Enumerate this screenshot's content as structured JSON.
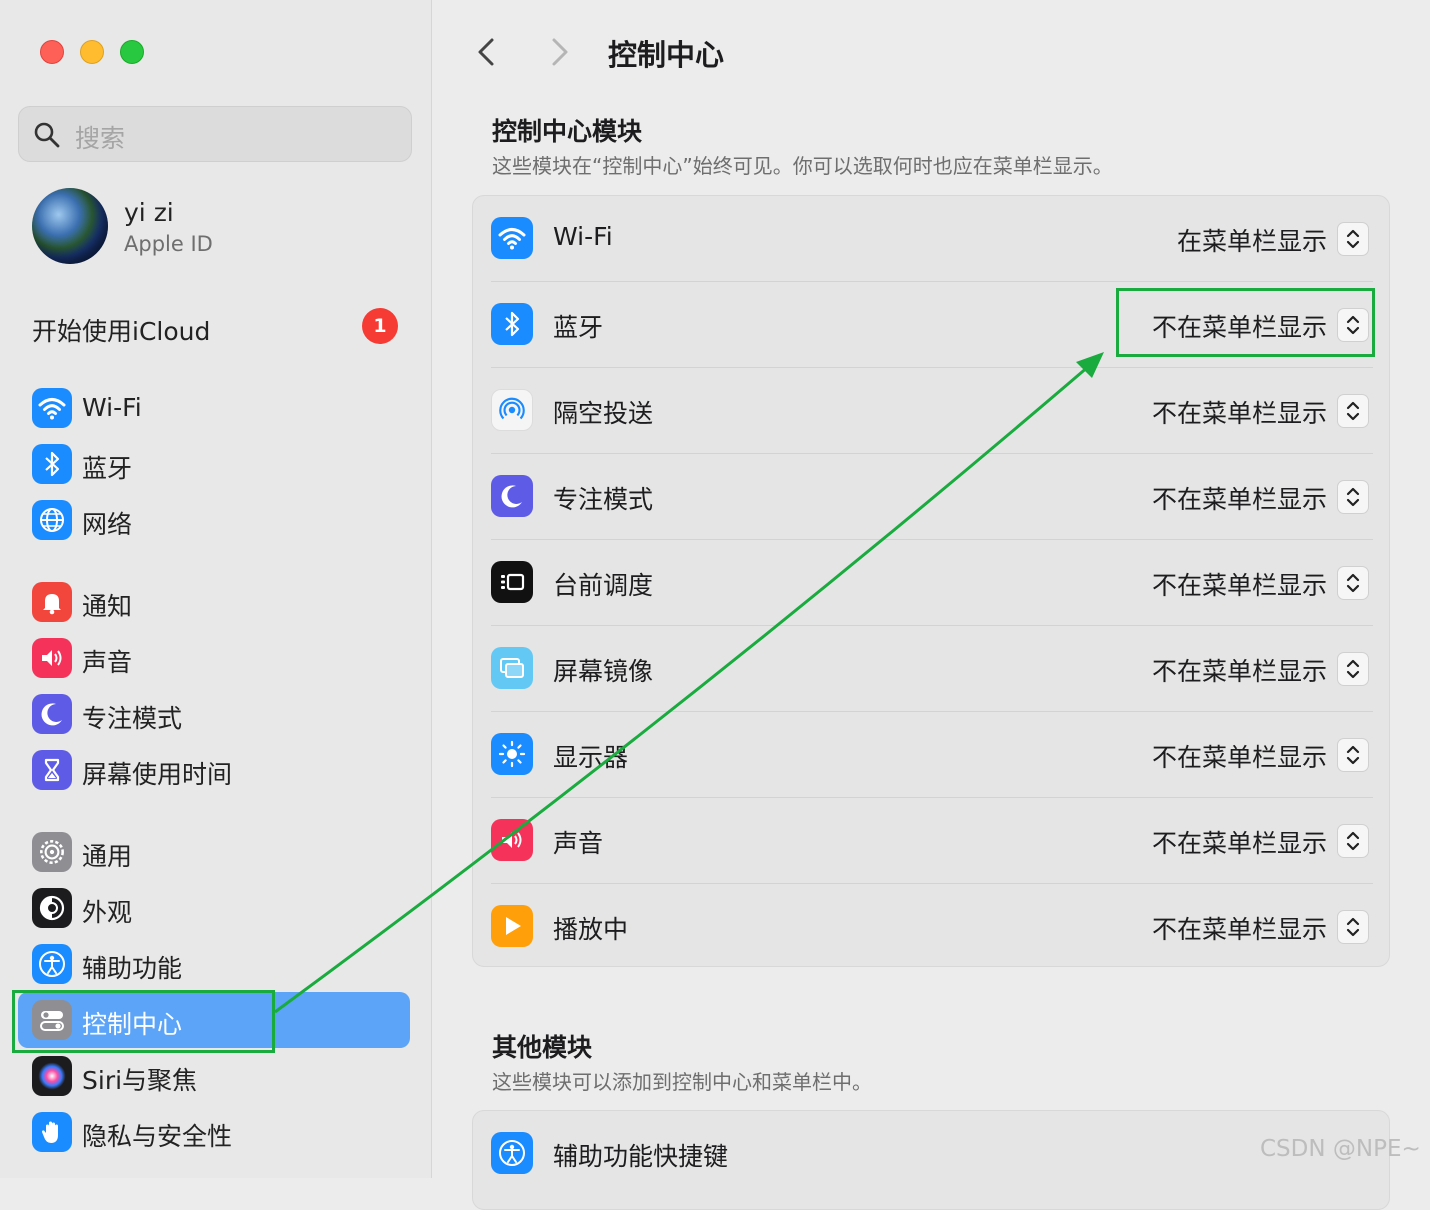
{
  "window": {
    "title": "控制中心"
  },
  "sidebar": {
    "search_placeholder": "搜索",
    "user": {
      "name": "yi zi",
      "subtitle": "Apple ID"
    },
    "icloud": {
      "label": "开始使用iCloud",
      "badge": "1"
    },
    "items": [
      {
        "label": "Wi-Fi",
        "icon": "wifi-icon",
        "color": "#1a8cff"
      },
      {
        "label": "蓝牙",
        "icon": "bluetooth-icon",
        "color": "#1a8cff"
      },
      {
        "label": "网络",
        "icon": "globe-icon",
        "color": "#1a8cff"
      },
      {
        "label": "通知",
        "icon": "bell-icon",
        "color": "#f2453c"
      },
      {
        "label": "声音",
        "icon": "speaker-icon",
        "color": "#f5325a"
      },
      {
        "label": "专注模式",
        "icon": "moon-icon",
        "color": "#5e5ce6"
      },
      {
        "label": "屏幕使用时间",
        "icon": "hourglass-icon",
        "color": "#5e5ce6"
      },
      {
        "label": "通用",
        "icon": "gear-icon",
        "color": "#8e8e93"
      },
      {
        "label": "外观",
        "icon": "appearance-icon",
        "color": "#1c1c1e"
      },
      {
        "label": "辅助功能",
        "icon": "accessibility-icon",
        "color": "#1a8cff"
      },
      {
        "label": "控制中心",
        "icon": "toggles-icon",
        "color": "#8e8e93",
        "selected": true
      },
      {
        "label": "Siri与聚焦",
        "icon": "siri-icon",
        "color": "#1c1c1e"
      },
      {
        "label": "隐私与安全性",
        "icon": "hand-icon",
        "color": "#1a8cff"
      }
    ]
  },
  "main": {
    "title": "控制中心",
    "modules_section": {
      "title": "控制中心模块",
      "description": "这些模块在“控制中心”始终可见。你可以选取何时也应在菜单栏显示。",
      "rows": [
        {
          "name": "Wi-Fi",
          "value": "在菜单栏显示",
          "icon": "wifi-icon",
          "color": "#1a8cff"
        },
        {
          "name": "蓝牙",
          "value": "不在菜单栏显示",
          "icon": "bluetooth-icon",
          "color": "#1a8cff"
        },
        {
          "name": "隔空投送",
          "value": "不在菜单栏显示",
          "icon": "airdrop-icon",
          "color": "#f5f5f5"
        },
        {
          "name": "专注模式",
          "value": "不在菜单栏显示",
          "icon": "moon-icon",
          "color": "#5e5ce6"
        },
        {
          "name": "台前调度",
          "value": "不在菜单栏显示",
          "icon": "stage-manager-icon",
          "color": "#111111"
        },
        {
          "name": "屏幕镜像",
          "value": "不在菜单栏显示",
          "icon": "screen-mirroring-icon",
          "color": "#64c8f5"
        },
        {
          "name": "显示器",
          "value": "不在菜单栏显示",
          "icon": "brightness-icon",
          "color": "#1a8cff"
        },
        {
          "name": "声音",
          "value": "不在菜单栏显示",
          "icon": "speaker-icon",
          "color": "#f5325a"
        },
        {
          "name": "播放中",
          "value": "不在菜单栏显示",
          "icon": "play-icon",
          "color": "#ff9f0a"
        }
      ]
    },
    "other_section": {
      "title": "其他模块",
      "description": "这些模块可以添加到控制中心和菜单栏中。",
      "rows": [
        {
          "name": "辅助功能快捷键",
          "icon": "accessibility-icon",
          "color": "#1a8cff"
        }
      ]
    }
  },
  "watermark": "CSDN @NPE~",
  "annotation_color": "#1aab3f"
}
